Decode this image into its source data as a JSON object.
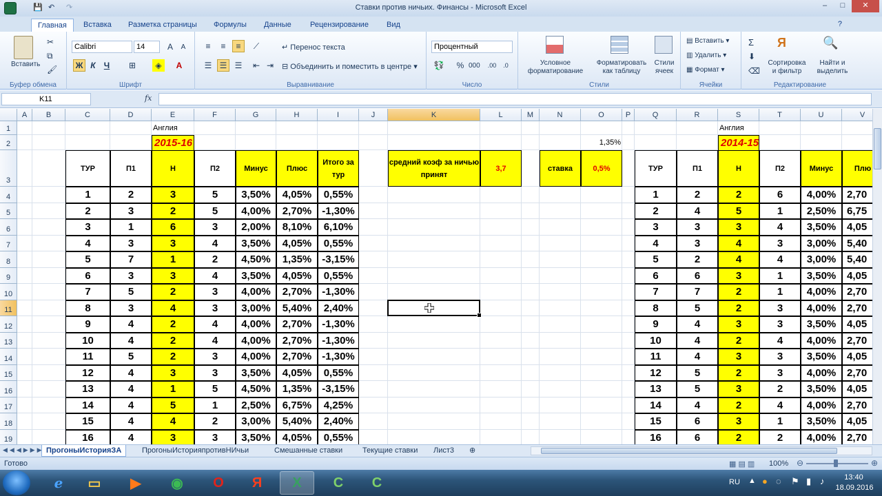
{
  "window": {
    "title": "Ставки против ничьих. Финансы - Microsoft Excel",
    "controls": [
      "–",
      "□",
      "✕"
    ]
  },
  "ribbon": {
    "tabs": [
      "Главная",
      "Вставка",
      "Разметка страницы",
      "Формулы",
      "Данные",
      "Рецензирование",
      "Вид"
    ],
    "active_tab": "Главная",
    "clipboard": {
      "paste": "Вставить",
      "label": "Буфер обмена"
    },
    "font": {
      "name": "Calibri",
      "size": "14",
      "bold": "Ж",
      "italic": "К",
      "underline": "Ч",
      "label": "Шрифт"
    },
    "alignment": {
      "wrap": "Перенос текста",
      "merge": "Объединить и поместить в центре",
      "label": "Выравнивание"
    },
    "number": {
      "format": "Процентный",
      "label": "Число"
    },
    "styles": {
      "conditional": "Условное форматирование",
      "as_table": "Форматировать как таблицу",
      "cell_styles": "Стили ячеек",
      "label": "Стили"
    },
    "cells": {
      "insert": "Вставить",
      "delete": "Удалить",
      "format": "Формат",
      "label": "Ячейки"
    },
    "editing": {
      "sort": "Сортировка и фильтр",
      "find": "Найти и выделить",
      "label": "Редактирование"
    }
  },
  "formula_bar": {
    "name_box": "K11",
    "fx": "fx",
    "value": ""
  },
  "grid": {
    "columns": [
      "A",
      "B",
      "C",
      "D",
      "E",
      "F",
      "G",
      "H",
      "I",
      "J",
      "K",
      "L",
      "M",
      "N",
      "O",
      "P",
      "Q",
      "R",
      "S",
      "T",
      "U",
      "V"
    ],
    "selected_col": "K",
    "rows": [
      "1",
      "2",
      "3",
      "4",
      "5",
      "6",
      "7",
      "8",
      "9",
      "10",
      "11",
      "12",
      "13",
      "14",
      "15",
      "16",
      "17",
      "18",
      "19"
    ],
    "selected_row": "11"
  },
  "left_table": {
    "league": "Англия",
    "season": "2015-16",
    "headers": [
      "ТУР",
      "П1",
      "Н",
      "П2",
      "Минус",
      "Плюс",
      "Итого за тур"
    ],
    "rows": [
      [
        "1",
        "2",
        "3",
        "5",
        "3,50%",
        "4,05%",
        "0,55%"
      ],
      [
        "2",
        "3",
        "2",
        "5",
        "4,00%",
        "2,70%",
        "-1,30%"
      ],
      [
        "3",
        "1",
        "6",
        "3",
        "2,00%",
        "8,10%",
        "6,10%"
      ],
      [
        "4",
        "3",
        "3",
        "4",
        "3,50%",
        "4,05%",
        "0,55%"
      ],
      [
        "5",
        "7",
        "1",
        "2",
        "4,50%",
        "1,35%",
        "-3,15%"
      ],
      [
        "6",
        "3",
        "3",
        "4",
        "3,50%",
        "4,05%",
        "0,55%"
      ],
      [
        "7",
        "5",
        "2",
        "3",
        "4,00%",
        "2,70%",
        "-1,30%"
      ],
      [
        "8",
        "3",
        "4",
        "3",
        "3,00%",
        "5,40%",
        "2,40%"
      ],
      [
        "9",
        "4",
        "2",
        "4",
        "4,00%",
        "2,70%",
        "-1,30%"
      ],
      [
        "10",
        "4",
        "2",
        "4",
        "4,00%",
        "2,70%",
        "-1,30%"
      ],
      [
        "11",
        "5",
        "2",
        "3",
        "4,00%",
        "2,70%",
        "-1,30%"
      ],
      [
        "12",
        "4",
        "3",
        "3",
        "3,50%",
        "4,05%",
        "0,55%"
      ],
      [
        "13",
        "4",
        "1",
        "5",
        "4,50%",
        "1,35%",
        "-3,15%"
      ],
      [
        "14",
        "4",
        "5",
        "1",
        "2,50%",
        "6,75%",
        "4,25%"
      ],
      [
        "15",
        "4",
        "4",
        "2",
        "3,00%",
        "5,40%",
        "2,40%"
      ],
      [
        "16",
        "4",
        "3",
        "3",
        "3,50%",
        "4,05%",
        "0,55%"
      ]
    ]
  },
  "info": {
    "avg_label": "средний коэф за ничью принят",
    "avg_value": "3,7",
    "stake_label": "ставка",
    "stake_value": "0,5%",
    "o2_value": "1,35%"
  },
  "right_table": {
    "league": "Англия",
    "season": "2014-15",
    "headers": [
      "ТУР",
      "П1",
      "Н",
      "П2",
      "Минус",
      "Плю"
    ],
    "rows": [
      [
        "1",
        "2",
        "2",
        "6",
        "4,00%",
        "2,70"
      ],
      [
        "2",
        "4",
        "5",
        "1",
        "2,50%",
        "6,75"
      ],
      [
        "3",
        "3",
        "3",
        "4",
        "3,50%",
        "4,05"
      ],
      [
        "4",
        "3",
        "4",
        "3",
        "3,00%",
        "5,40"
      ],
      [
        "5",
        "2",
        "4",
        "4",
        "3,00%",
        "5,40"
      ],
      [
        "6",
        "6",
        "3",
        "1",
        "3,50%",
        "4,05"
      ],
      [
        "7",
        "7",
        "2",
        "1",
        "4,00%",
        "2,70"
      ],
      [
        "8",
        "5",
        "2",
        "3",
        "4,00%",
        "2,70"
      ],
      [
        "9",
        "4",
        "3",
        "3",
        "3,50%",
        "4,05"
      ],
      [
        "10",
        "4",
        "2",
        "4",
        "4,00%",
        "2,70"
      ],
      [
        "11",
        "4",
        "3",
        "3",
        "3,50%",
        "4,05"
      ],
      [
        "12",
        "5",
        "2",
        "3",
        "4,00%",
        "2,70"
      ],
      [
        "13",
        "5",
        "3",
        "2",
        "3,50%",
        "4,05"
      ],
      [
        "14",
        "4",
        "2",
        "4",
        "4,00%",
        "2,70"
      ],
      [
        "15",
        "6",
        "3",
        "1",
        "3,50%",
        "4,05"
      ],
      [
        "16",
        "6",
        "2",
        "2",
        "4,00%",
        "2,70"
      ]
    ]
  },
  "sheets": [
    "ПрогоныИсторияЗА",
    "ПрогоныИсторияпротивНИчьи",
    "Смешанные ставки",
    "Текущие ставки",
    "Лист3"
  ],
  "active_sheet": "ПрогоныИсторияЗА",
  "status": {
    "ready": "Готово",
    "zoom": "100%"
  },
  "taskbar": {
    "lang": "RU",
    "time": "13:40",
    "date": "18.09.2016"
  },
  "colors": {
    "yellow": "#ffff00",
    "season_red": "#e00000",
    "excel_green": "#1e7145"
  }
}
